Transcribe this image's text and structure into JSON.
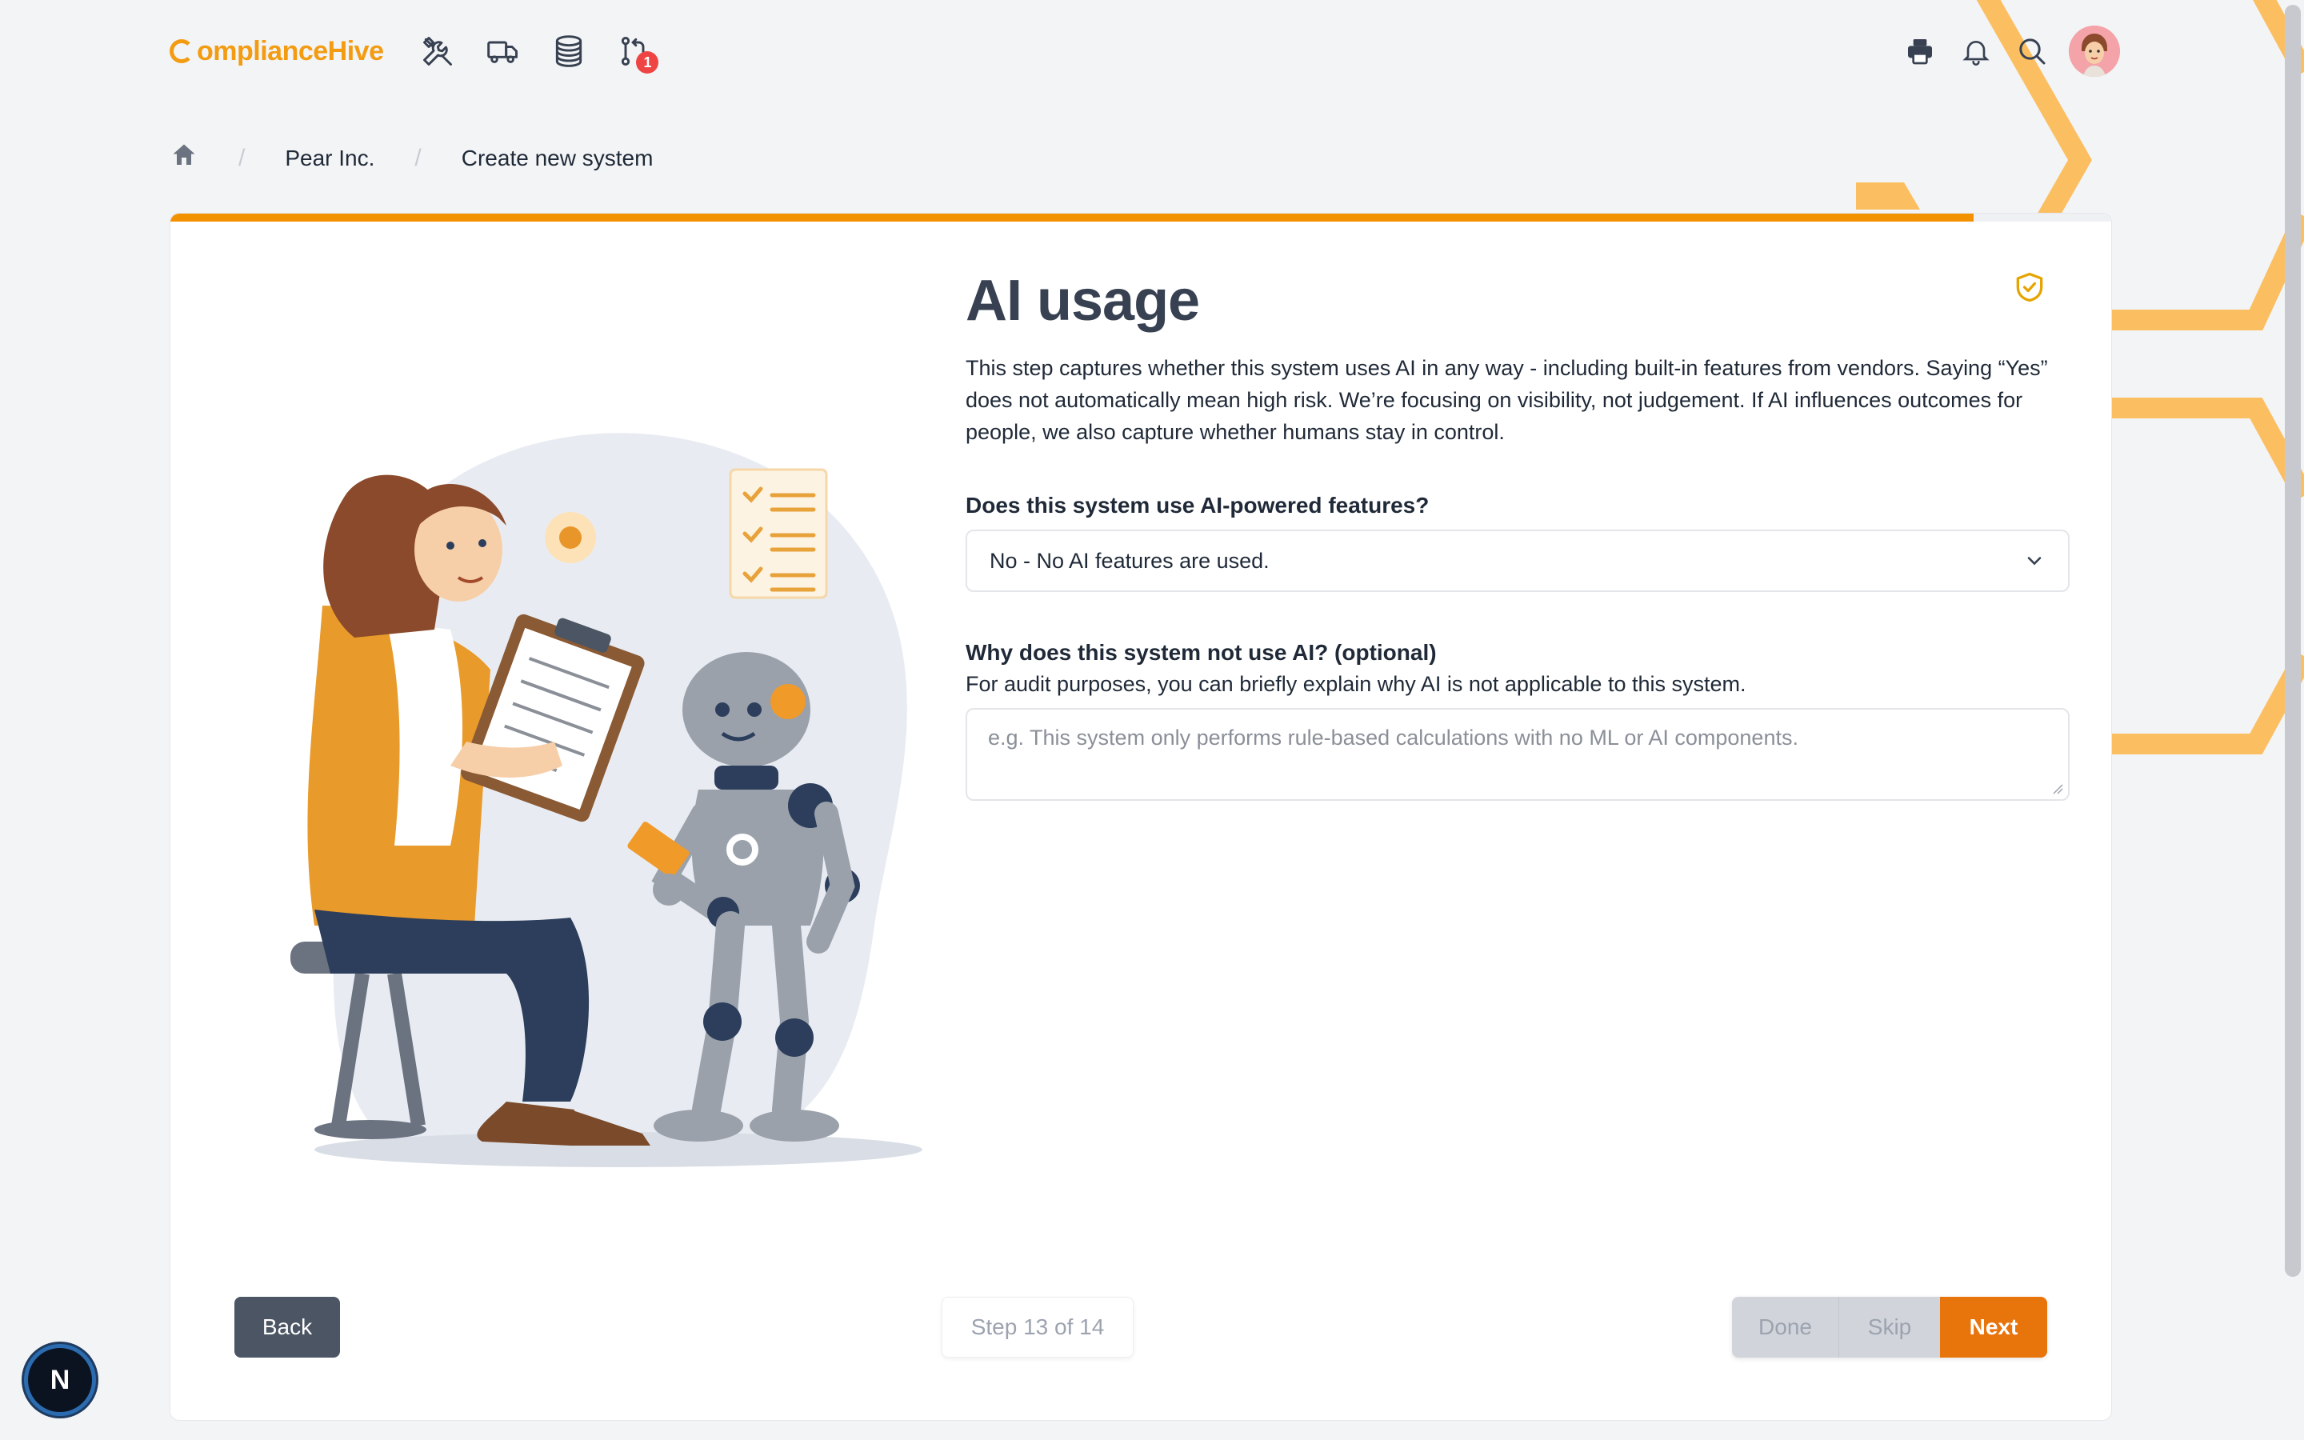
{
  "app": {
    "logo_text": "omplianceHive",
    "logo_initial": "C"
  },
  "topnav": {
    "icons": [
      "tools-icon",
      "truck-icon",
      "database-icon",
      "pull-request-icon"
    ],
    "notification_badge": "1",
    "right_icons": [
      "printer-icon",
      "bell-icon",
      "search-icon",
      "avatar"
    ]
  },
  "breadcrumb": {
    "items": [
      "Pear Inc.",
      "Create new system"
    ]
  },
  "progress": {
    "fraction": 0.929
  },
  "page": {
    "title": "AI usage",
    "intro": "This step captures whether this system uses AI in any way - including built-in features from vendors. Saying “Yes” does not automatically mean high risk. We’re focusing on visibility, not judgement. If AI influences outcomes for people, we also capture whether humans stay in control.",
    "q1_label": "Does this system use AI-powered features?",
    "q1_value": "No - No AI features are used.",
    "q2_label": "Why does this system not use AI? (optional)",
    "q2_helper": "For audit purposes, you can briefly explain why AI is not applicable to this system.",
    "q2_placeholder": "e.g. This system only performs rule-based calculations with no ML or AI components."
  },
  "footer": {
    "back": "Back",
    "step": "Step 13 of 14",
    "done": "Done",
    "skip": "Skip",
    "next": "Next"
  },
  "dev_badge": "N",
  "colors": {
    "accent": "#f39200",
    "next_button": "#e8740c",
    "back_button": "#4b5563"
  }
}
